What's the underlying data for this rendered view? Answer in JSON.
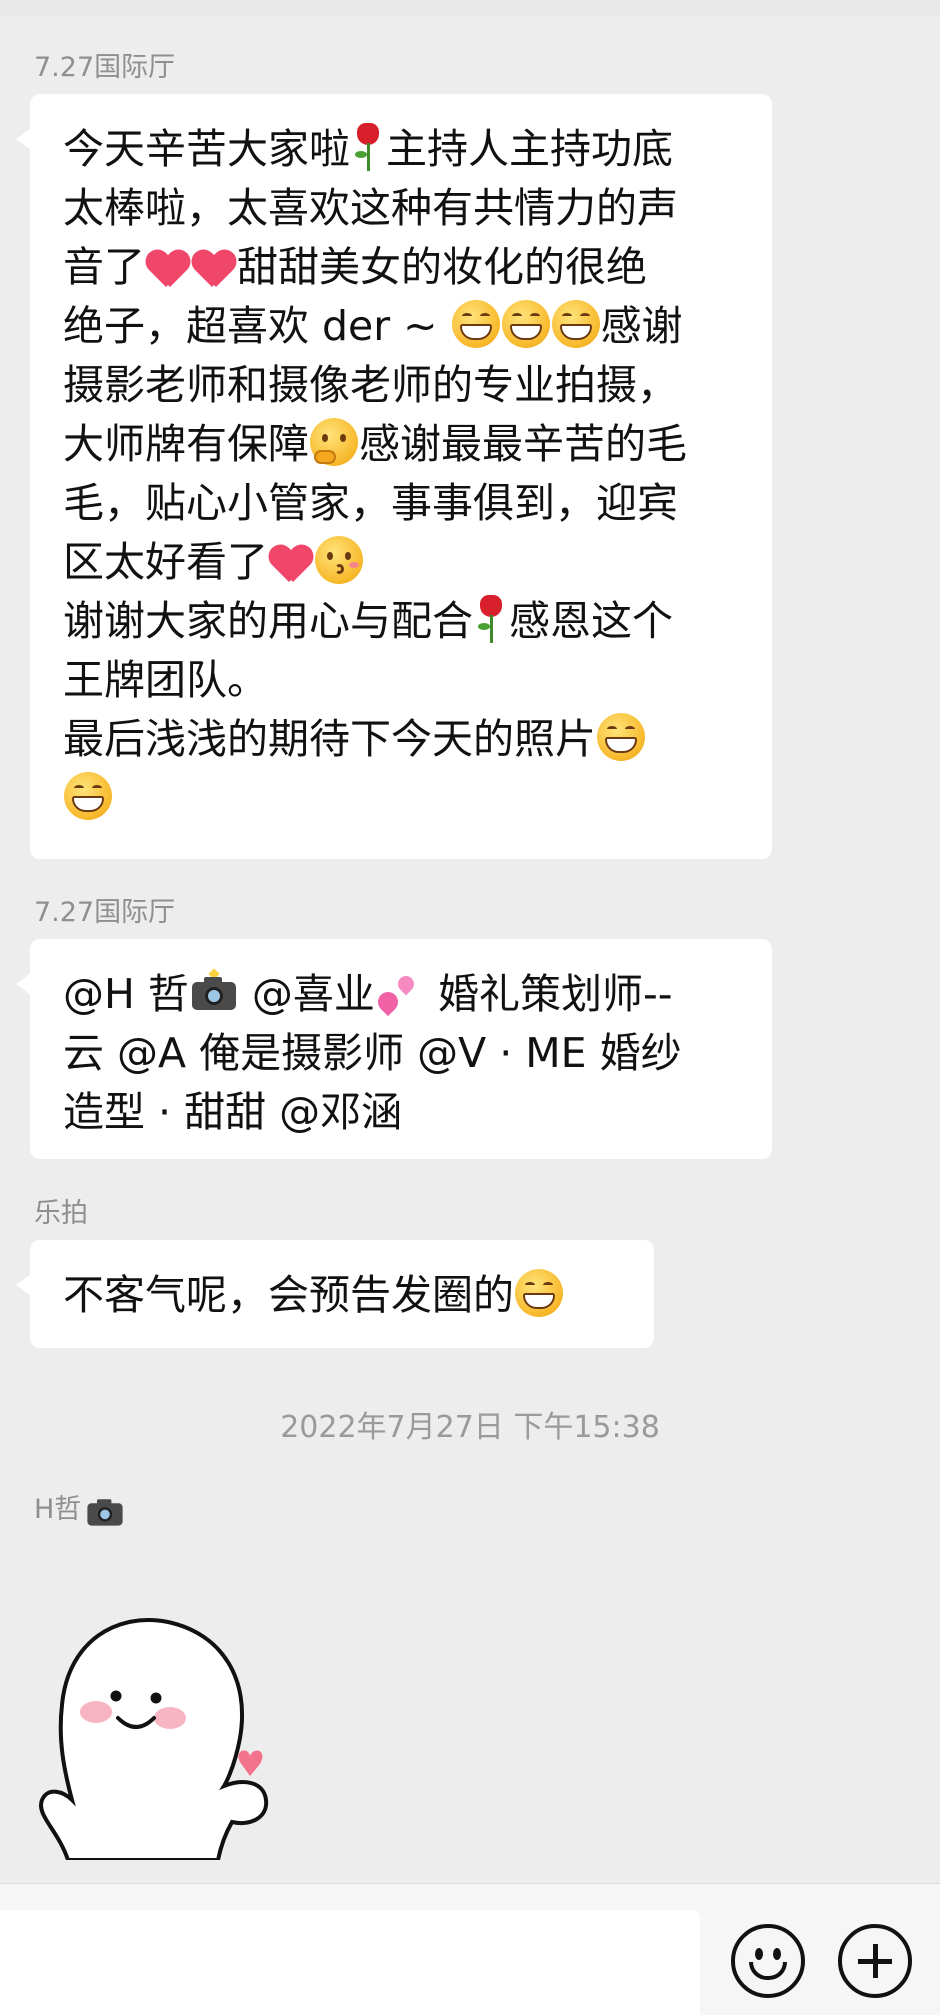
{
  "messages": [
    {
      "sender": "7.27国际厅",
      "lines": [
        [
          "今天辛苦大家啦",
          "{rose}",
          "主持人主持功底"
        ],
        [
          "太棒啦，太喜欢这种有共情力的声"
        ],
        [
          "音了",
          "{heart}",
          "{heart}",
          "甜甜美女的妆化的很绝"
        ],
        [
          "绝子，超喜欢 der ~ ",
          "{grin}",
          "{grin}",
          "{grin}",
          "感谢"
        ],
        [
          "摄影老师和摄像老师的专业拍摄，"
        ],
        [
          "大师牌有保障",
          "{think}",
          "感谢最最辛苦的毛"
        ],
        [
          "毛，贴心小管家，事事俱到，迎宾"
        ],
        [
          "区太好看了",
          "{heart}",
          "{kiss}"
        ],
        [
          "谢谢大家的用心与配合",
          "{rose}",
          "感恩这个"
        ],
        [
          "王牌团队。"
        ],
        [
          "最后浅浅的期待下今天的照片",
          "{grin}"
        ],
        [
          "{grin}"
        ]
      ]
    },
    {
      "sender": "7.27国际厅",
      "lines": [
        [
          "@H 哲",
          "{camera}",
          " @喜业",
          "{twohearts}",
          " 婚礼策划师--"
        ],
        [
          "云 @A 俺是摄影师 @V · ME 婚纱"
        ],
        [
          "造型 · 甜甜 @邓涵"
        ]
      ]
    },
    {
      "sender": "乐拍",
      "lines": [
        [
          "不客气呢，会预告发圈的",
          "{grin}"
        ]
      ]
    }
  ],
  "timestamp": "2022年7月27日 下午15:38",
  "last_sender": {
    "name": "H哲",
    "icon": "camera-icon"
  },
  "sticker": {
    "name": "smiling-blob-finger-heart-sticker"
  },
  "input_bar": {
    "placeholder": "",
    "emoji_icon": "emoji-smile-icon",
    "plus_icon": "plus-circle-icon"
  },
  "colors": {
    "background": "#ededed",
    "bubble": "#ffffff",
    "sender_text": "#8f8f8f",
    "heart": "#f0466a",
    "emoji_yellow": "#f7b82a"
  }
}
